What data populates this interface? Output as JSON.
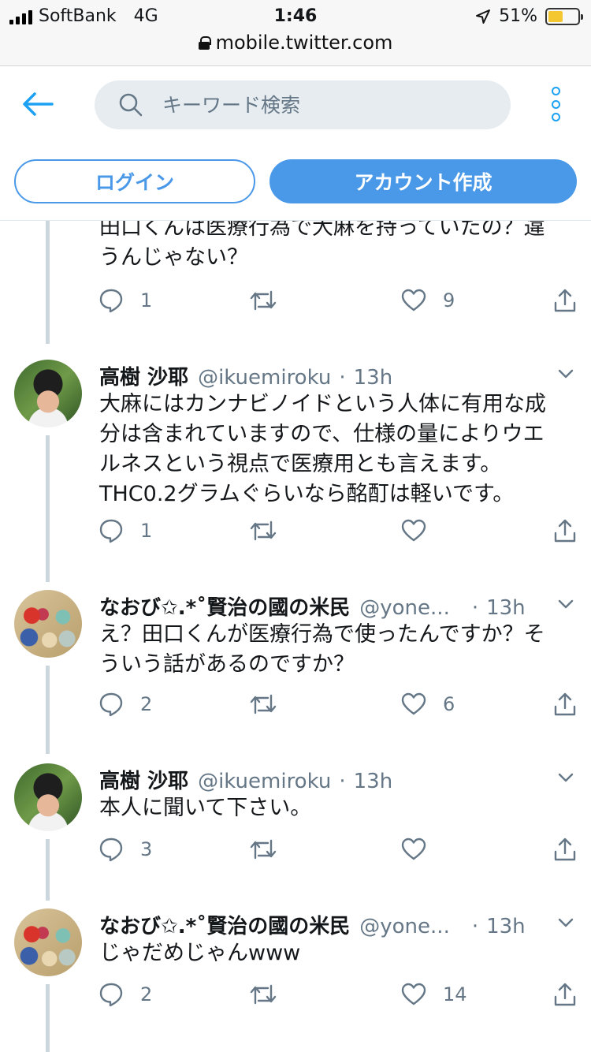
{
  "status_bar": {
    "carrier": "SoftBank",
    "network": "4G",
    "time": "1:46",
    "battery_percent": "51%",
    "battery_level": 0.51,
    "url": "mobile.twitter.com",
    "icons": [
      "signal-icon",
      "location-arrow-icon",
      "battery-icon",
      "lock-icon"
    ]
  },
  "header": {
    "search_placeholder": "キーワード検索",
    "login_label": "ログイン",
    "signup_label": "アカウント作成",
    "accent_color": "#4a99e9",
    "icons": [
      "back-arrow-icon",
      "search-icon",
      "more-vertical-icon"
    ]
  },
  "tweets": [
    {
      "text_lines": [
        "田口くんは医療行為で大麻を持っていたの？違",
        "うんじゃない？"
      ],
      "reply_count": "1",
      "retweet_count": "",
      "like_count": "9"
    },
    {
      "name": "高樹 沙耶",
      "handle": "@ikuemiroku",
      "time": "13h",
      "text_lines": [
        "大麻にはカンナビノイドという人体に有用な成",
        "分は含まれていますので、仕様の量によりウエ",
        "ルネスという視点で医療用とも言えます。",
        "THC0.2グラムぐらいなら酩酊は軽いです。"
      ],
      "reply_count": "1",
      "retweet_count": "",
      "like_count": ""
    },
    {
      "name": "なおび✩.*˚賢治の國の米民",
      "handle": "@yone...",
      "time": "13h",
      "text_lines": [
        "え？田口くんが医療行為で使ったんですか？そ",
        "ういう話があるのですか？"
      ],
      "reply_count": "2",
      "retweet_count": "",
      "like_count": "6"
    },
    {
      "name": "高樹 沙耶",
      "handle": "@ikuemiroku",
      "time": "13h",
      "text_lines": [
        "本人に聞いて下さい。"
      ],
      "reply_count": "3",
      "retweet_count": "",
      "like_count": ""
    },
    {
      "name": "なおび✩.*˚賢治の國の米民",
      "handle": "@yone...",
      "time": "13h",
      "text_lines": [
        "じゃだめじゃんwww"
      ],
      "reply_count": "2",
      "retweet_count": "",
      "like_count": "14"
    }
  ]
}
